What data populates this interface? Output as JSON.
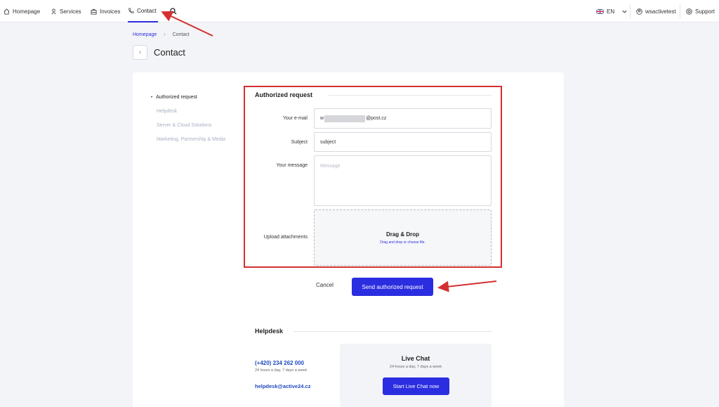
{
  "nav": {
    "items": [
      {
        "label": "Homepage",
        "icon": "home-icon"
      },
      {
        "label": "Services",
        "icon": "services-icon"
      },
      {
        "label": "Invoices",
        "icon": "invoices-icon"
      },
      {
        "label": "Contact",
        "icon": "phone-icon"
      }
    ],
    "language": "EN",
    "username": "wsactivetest",
    "support": "Support"
  },
  "breadcrumb": {
    "home": "Homepage",
    "current": "Contact"
  },
  "page_title": "Contact",
  "side_menu": [
    "Authorized request",
    "Helpdesk",
    "Server & Cloud Solutions",
    "Marketing, Partnership & Media"
  ],
  "form": {
    "title": "Authorized request",
    "email_label": "Your e-mail",
    "email_prefix": "w",
    "email_suffix": "@post.cz",
    "subject_label": "Subject",
    "subject_value": "subject",
    "message_label": "Your message",
    "message_placeholder": "Message",
    "upload_label": "Upload attachments",
    "dropzone_title": "Drag & Drop",
    "dropzone_sub": "Drag and drop or choose file.",
    "cancel": "Cancel",
    "submit": "Send authorized request"
  },
  "helpdesk": {
    "title": "Helpdesk",
    "phone": "(+420) 234 262 000",
    "hours": "24 hours a day, 7 days a week",
    "email": "helpdesk@active24.cz",
    "chat_title": "Live Chat",
    "chat_hours": "24 hours a day, 7 days a week",
    "chat_button": "Start Live Chat now"
  },
  "colors": {
    "accent": "#2b2ee0",
    "annotation": "#d43030",
    "link": "#1e4bbf"
  }
}
